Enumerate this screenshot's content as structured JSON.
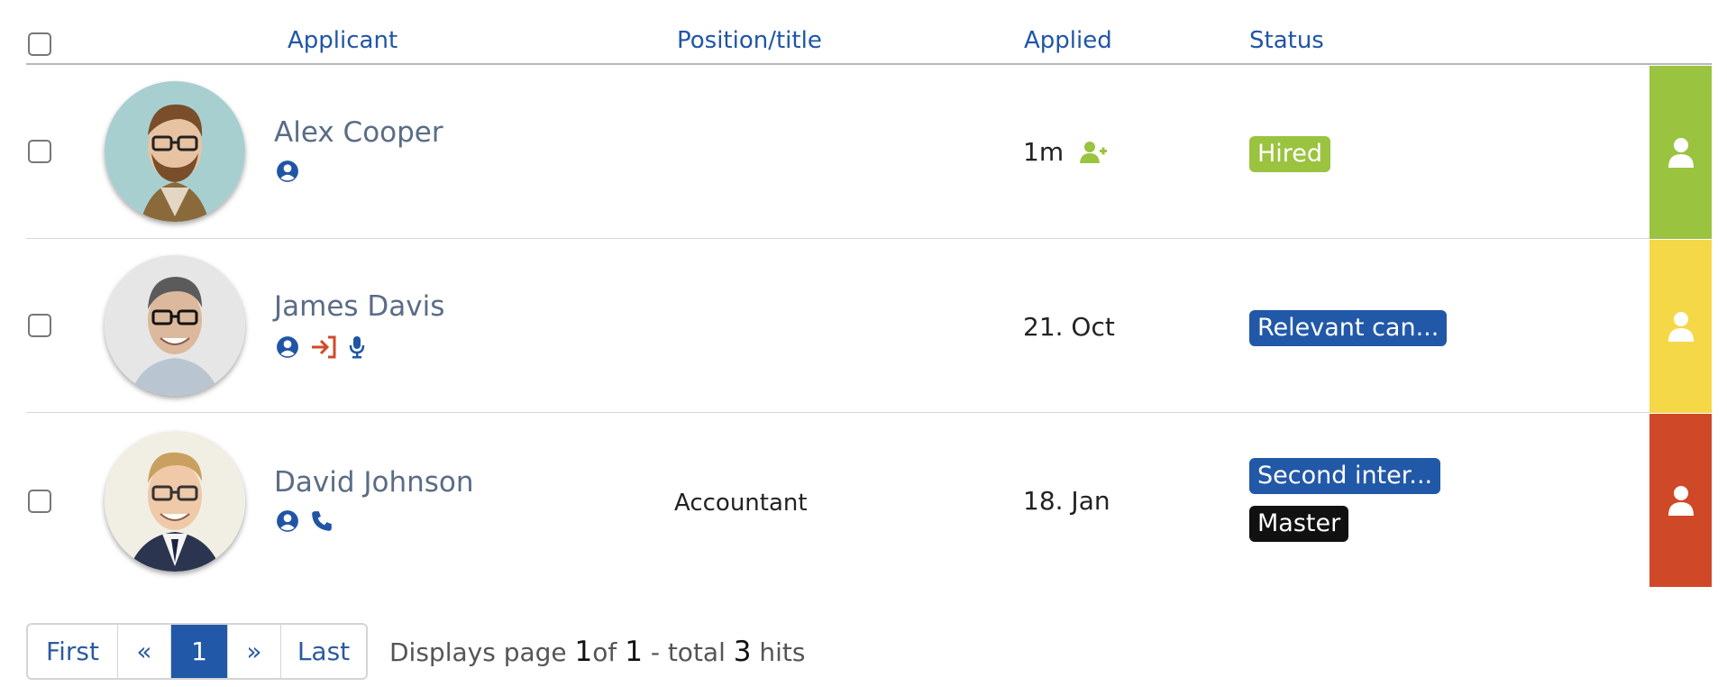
{
  "header": {
    "applicant": "Applicant",
    "position": "Position/title",
    "applied": "Applied",
    "status": "Status"
  },
  "rows": [
    {
      "name": "Alex Cooper",
      "position": "",
      "applied": "1m",
      "badges": [
        {
          "label": "Hired",
          "color": "#9ac340"
        }
      ],
      "side_color": "#9ac340",
      "icons": [
        "user-circle-icon"
      ],
      "applied_icon": "user-plus-icon"
    },
    {
      "name": "James Davis",
      "position": "",
      "applied": "21. Oct",
      "badges": [
        {
          "label": "Relevant can...",
          "color": "#2258a8"
        }
      ],
      "side_color": "#f5d847",
      "icons": [
        "user-circle-icon",
        "sign-in-icon",
        "microphone-icon"
      ]
    },
    {
      "name": "David Johnson",
      "position": "Accountant",
      "applied": "18. Jan",
      "badges": [
        {
          "label": "Second inter...",
          "color": "#2258a8"
        },
        {
          "label": "Master",
          "color": "#111111"
        }
      ],
      "side_color": "#cf4827",
      "icons": [
        "user-circle-icon",
        "phone-icon"
      ]
    }
  ],
  "pagination": {
    "first": "First",
    "prev": "«",
    "current": "1",
    "next": "»",
    "last": "Last",
    "info_prefix": "Displays page",
    "page": "1",
    "of_label": "of",
    "total_pages": "1",
    "total_label": "- total",
    "total_hits": "3",
    "hits_label": "hits"
  },
  "colors": {
    "link_blue": "#2055a6",
    "hired_green": "#9ac340",
    "yellow": "#f5d847",
    "red": "#cf4827"
  }
}
